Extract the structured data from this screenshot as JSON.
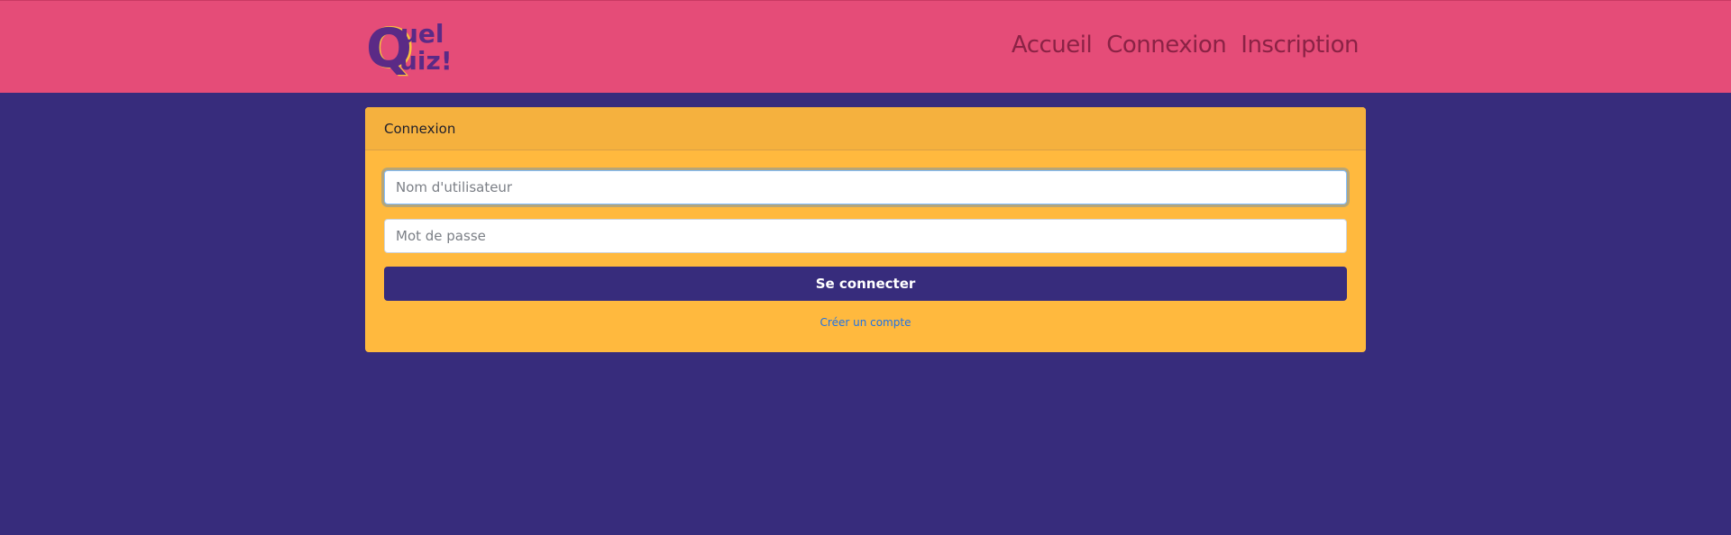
{
  "header": {
    "logo_top": "uel",
    "logo_bottom": "uiz!",
    "logo_letter": "Q",
    "nav": [
      {
        "label": "Accueil"
      },
      {
        "label": "Connexion"
      },
      {
        "label": "Inscription"
      }
    ]
  },
  "login_card": {
    "title": "Connexion",
    "username_placeholder": "Nom d'utilisateur",
    "password_placeholder": "Mot de passe",
    "submit_label": "Se connecter",
    "create_account_link": "Créer un compte"
  },
  "colors": {
    "background": "#372c7c",
    "navbar": "#e54c78",
    "card": "#ffb93e",
    "button": "#372c7c",
    "link": "#1f73e6"
  }
}
